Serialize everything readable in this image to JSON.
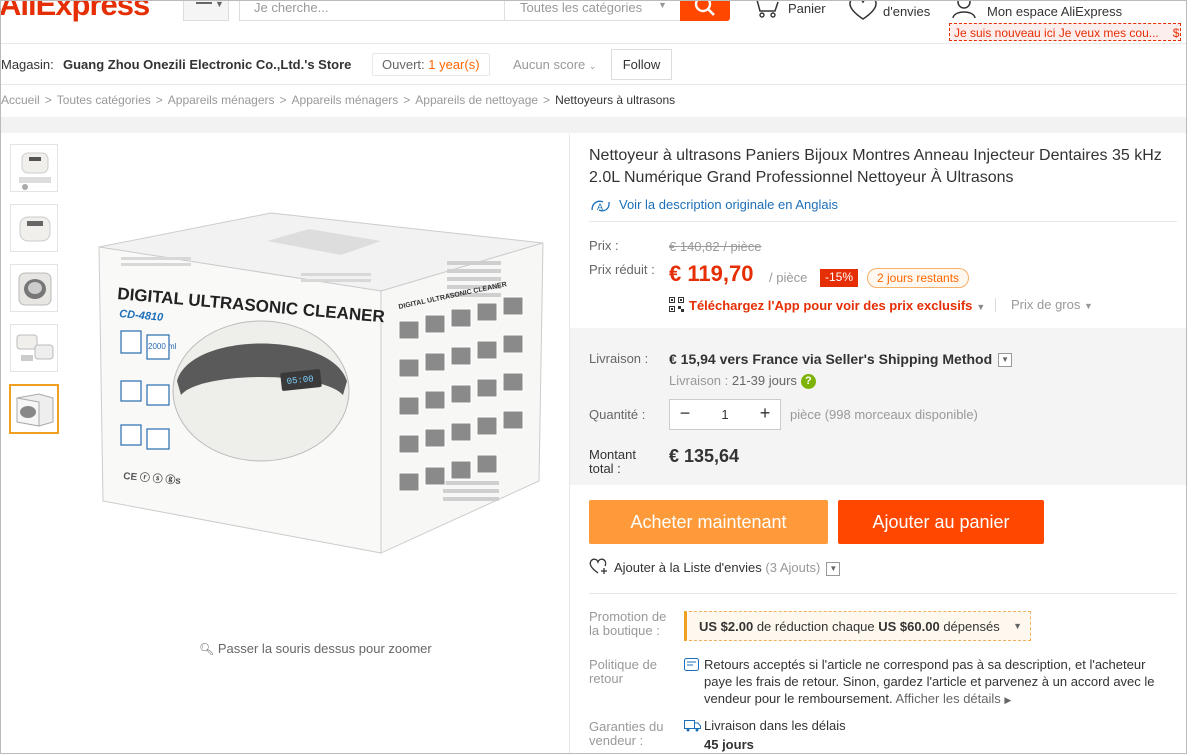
{
  "header": {
    "logo": "AliExpress",
    "search_placeholder": "Je cherche...",
    "search_category": "Toutes les catégories",
    "cart_label": "Panier",
    "wishlist_label": "d'envies",
    "account_label": "Mon espace AliExpress",
    "newbie_label": "Je suis nouveau ici Je veux mes cou...",
    "newbie_extra": "$"
  },
  "store": {
    "label": "Magasin:",
    "name": "Guang Zhou Onezili Electronic Co.,Ltd.'s Store",
    "open_label": "Ouvert:",
    "open_years": "1 year(s)",
    "score": "Aucun score",
    "follow": "Follow"
  },
  "breadcrumb": [
    "Accueil",
    "Toutes catégories",
    "Appareils ménagers",
    "Appareils ménagers",
    "Appareils de nettoyage",
    "Nettoyeurs à ultrasons"
  ],
  "gallery": {
    "zoom_hint": "Passer la souris dessus pour zoomer",
    "box_title": "DIGITAL ULTRASONIC CLEANER",
    "box_model": "CD-4810",
    "box_side_title": "DIGITAL ULTRASONIC CLEANER",
    "box_capacity": "2000 ml",
    "box_display": "05:00"
  },
  "product": {
    "title": "Nettoyeur à ultrasons Paniers Bijoux Montres Anneau Injecteur Dentaires 35 kHz 2.0L Numérique Grand Professionnel Nettoyeur À Ultrasons",
    "translate_link": "Voir la description originale en Anglais",
    "price_label": "Prix :",
    "old_price": "€ 140,82 / pièce",
    "reduced_label": "Prix réduit :",
    "new_price": "€ 119,70",
    "unit": "/ pièce",
    "discount": "-15%",
    "days_left": "2 jours restants",
    "app_promo": "Téléchargez l'App pour voir des prix exclusifs",
    "wholesale": "Prix de gros"
  },
  "shipping": {
    "label": "Livraison :",
    "cost": "€ 15,94",
    "to": "vers",
    "dest": "France via Seller's Shipping Method",
    "delay_label": "Livraison :",
    "delay": "21-39 jours"
  },
  "quantity": {
    "label": "Quantité :",
    "value": "1",
    "info": "pièce (998 morceaux disponible)"
  },
  "total": {
    "label_1": "Montant",
    "label_2": "total :",
    "value": "€ 135,64"
  },
  "actions": {
    "buy_now": "Acheter maintenant",
    "add_to_cart": "Ajouter au panier",
    "wishlist": "Ajouter à la Liste d'envies",
    "wishlist_count": "(3 Ajouts)"
  },
  "promotion": {
    "label_1": "Promotion de",
    "label_2": "la boutique :",
    "amount": "US $2.00",
    "mid": "de réduction chaque",
    "threshold": "US $60.00",
    "end": "dépensés"
  },
  "returns": {
    "label_1": "Politique de",
    "label_2": "retour",
    "text": "Retours acceptés si l'article ne correspond pas à sa description, et l'acheteur paye les frais de retour. Sinon, gardez l'article et parvenez à un accord avec le vendeur pour le remboursement.",
    "more": "Afficher les détails"
  },
  "guarantee": {
    "label_1": "Garanties du",
    "label_2": "vendeur :",
    "line1": "Livraison dans les délais",
    "line2": "45 jours"
  },
  "colors": {
    "brand": "#e62e04",
    "buy": "#ff9a3a",
    "cart": "#ff4700",
    "link": "#1c6fb8"
  }
}
